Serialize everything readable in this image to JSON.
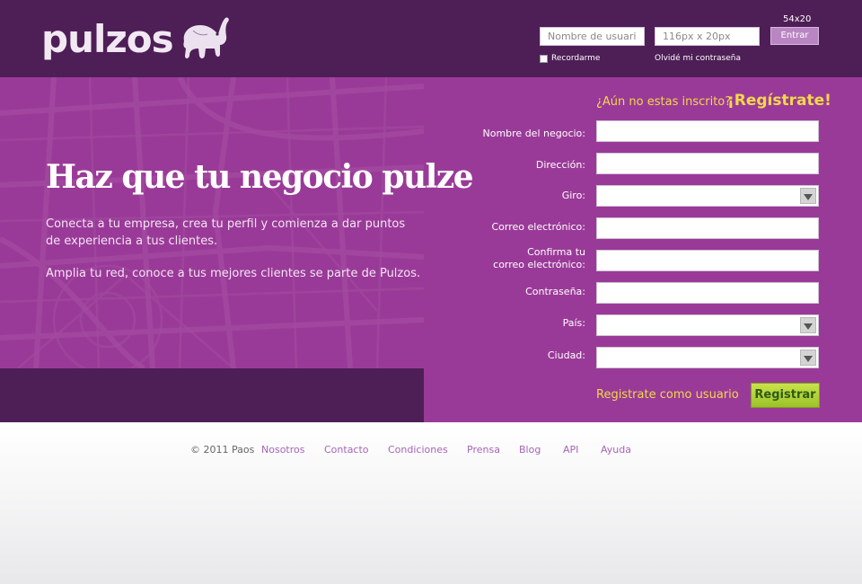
{
  "header": {
    "brand": "pulzos",
    "username_placeholder": "Nombre de usuario",
    "password_placeholder": "116px x 20px",
    "size_note": "54x20",
    "enter_label": "Entrar",
    "remember_label": "Recordarme",
    "forgot_label": "Olvidé mi contraseña"
  },
  "hero": {
    "title": "Haz que tu negocio pulze",
    "paragraph1": "Conecta a tu empresa, crea tu perfil y comienza a dar puntos de experiencia a tus clientes.",
    "paragraph2": "Amplia tu red, conoce a tus mejores clientes se parte de Pulzos."
  },
  "register": {
    "question": "¿Aún no estas inscrito?",
    "cta": "¡Regístrate!",
    "fields": {
      "business_name": "Nombre del negocio:",
      "address": "Dirección:",
      "category": "Giro:",
      "email": "Correo electrónico:",
      "confirm_email_line1": "Confirma tu",
      "confirm_email_line2": "correo electrónico:",
      "password": "Contraseña:",
      "country": "País:",
      "city": "Ciudad:"
    },
    "user_link": "Registrate como usuario",
    "submit_label": "Registrar"
  },
  "footer": {
    "copyright": "© 2011 Paos",
    "links": [
      "Nosotros",
      "Contacto",
      "Condiciones",
      "Prensa",
      "Blog",
      "API",
      "Ayuda"
    ]
  },
  "colors": {
    "header_bg": "#4e1e56",
    "hero_bg": "#9a3a98",
    "accent_yellow": "#f2d84a",
    "register_green": "#a8cc30",
    "link_purple": "#a765b8"
  }
}
